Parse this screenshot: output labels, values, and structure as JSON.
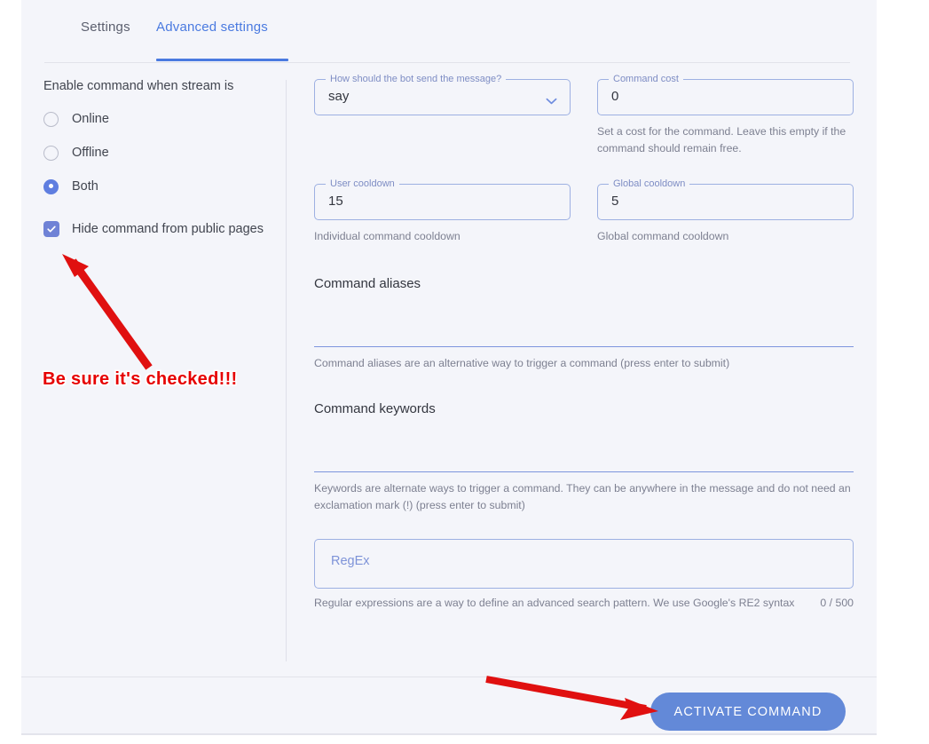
{
  "tabs": [
    {
      "id": "settings",
      "label": "Settings",
      "active": false
    },
    {
      "id": "advanced",
      "label": "Advanced settings",
      "active": true
    }
  ],
  "left_panel": {
    "group_label": "Enable command when stream is",
    "radios": [
      {
        "label": "Online",
        "checked": false
      },
      {
        "label": "Offline",
        "checked": false
      },
      {
        "label": "Both",
        "checked": true
      }
    ],
    "checkbox": {
      "label": "Hide command from public pages",
      "checked": true,
      "color": "#6f82d6"
    }
  },
  "form": {
    "send_mode": {
      "legend": "How should the bot send the message?",
      "value": "say",
      "icon": "chevron-down-icon"
    },
    "command_cost": {
      "legend": "Command cost",
      "value": "0",
      "helper": "Set a cost for the command. Leave this empty if the command should remain free."
    },
    "user_cooldown": {
      "legend": "User cooldown",
      "value": "15",
      "helper": "Individual command cooldown"
    },
    "global_cooldown": {
      "legend": "Global cooldown",
      "value": "5",
      "helper": "Global command cooldown"
    },
    "command_aliases": {
      "title": "Command aliases",
      "value": "",
      "helper": "Command aliases are an alternative way to trigger a command (press enter to submit)"
    },
    "command_keywords": {
      "title": "Command keywords",
      "value": "",
      "helper": "Keywords are alternate ways to trigger a command. They can be anywhere in the message and do not need an exclamation mark (!) (press enter to submit)"
    },
    "regex": {
      "placeholder": "RegEx",
      "value": "",
      "helper": "Regular expressions are a way to define an advanced search pattern. We use Google's RE2 syntax",
      "counter": "0 / 500"
    }
  },
  "footer": {
    "activate_label": "ACTIVATE COMMAND",
    "accent": "#6389d8"
  },
  "annotations": {
    "note": "Be sure it's checked!!!",
    "color": "#e60000",
    "arrow_to_checkbox": "arrow-icon",
    "arrow_to_button": "arrow-icon"
  },
  "theme": {
    "page_background": "#ffffff",
    "card_background": "#f4f5fa",
    "tab_accent": "#4a7ae0",
    "field_border": "#9db0e2",
    "legend_color": "#7e8dc4",
    "helper_color": "#7d8091"
  }
}
